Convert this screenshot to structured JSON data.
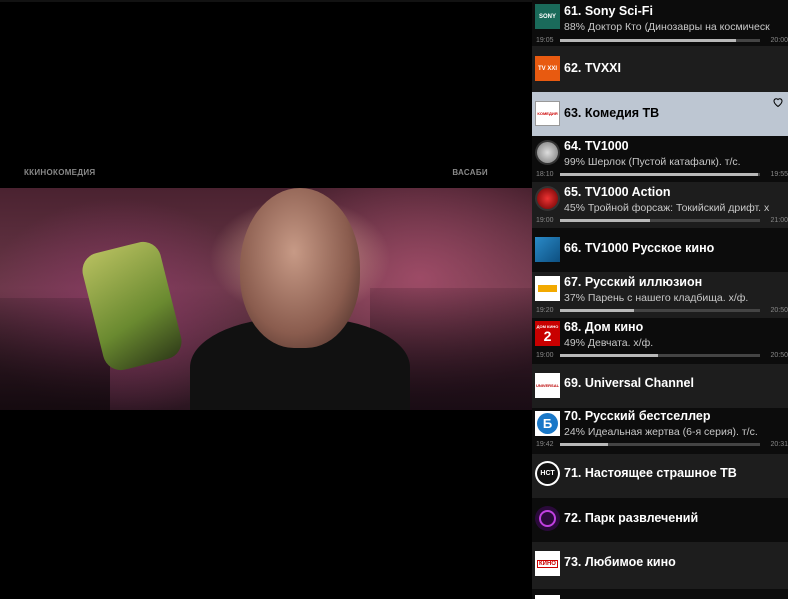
{
  "player": {
    "osd_left": "ККИНОКОМЕДИЯ",
    "osd_right": "ВАСАБИ"
  },
  "channels": [
    {
      "title": "61. Sony Sci-Fi",
      "program": "88% Доктор Кто (Динозавры на космическ",
      "start": "19:05",
      "end": "20:00",
      "progress": 0.88,
      "logo": "sony-scifi-logo",
      "logo_text": "SONY"
    },
    {
      "title": "62. TVXXI",
      "logo": "tvxxi-logo",
      "logo_text": "TV XXI"
    },
    {
      "title": "63. Комедия ТВ",
      "logo": "comedy-tv-logo",
      "logo_text": "КОМЕДИЯ",
      "selected": true,
      "favorite_icon": "heart-icon"
    },
    {
      "title": "64. TV1000",
      "program": "99% Шерлок (Пустой катафалк). т/с.",
      "start": "18:10",
      "end": "19:55",
      "progress": 0.99,
      "logo": "tv1000-logo",
      "logo_text": ""
    },
    {
      "title": "65. TV1000 Action",
      "program": "45% Тройной форсаж: Токийский дрифт. х",
      "start": "19:00",
      "end": "21:00",
      "progress": 0.45,
      "logo": "tv1000-action-logo",
      "logo_text": ""
    },
    {
      "title": "66. TV1000 Русское кино",
      "logo": "tv1000-russian-logo",
      "logo_text": ""
    },
    {
      "title": "67. Русский иллюзион",
      "program": "37% Парень с нашего кладбища. х/ф.",
      "start": "19:20",
      "end": "20:50",
      "progress": 0.37,
      "logo": "russian-illusion-logo",
      "logo_text": ""
    },
    {
      "title": "68. Дом кино",
      "program": "49% Девчата. х/ф.",
      "start": "19:00",
      "end": "20:50",
      "progress": 0.49,
      "logo": "dom-kino-logo",
      "logo_text": "ДОМ КИНО"
    },
    {
      "title": "69. Universal Channel",
      "logo": "universal-logo",
      "logo_text": "UNIVERSAL"
    },
    {
      "title": "70. Русский бестселлер",
      "program": "24% Идеальная жертва (6-я серия). т/с.",
      "start": "19:42",
      "end": "20:31",
      "progress": 0.24,
      "logo": "bestseller-logo",
      "logo_text": "Б"
    },
    {
      "title": "71. Настоящее страшное ТВ",
      "logo": "scary-tv-logo",
      "logo_text": "НСТ"
    },
    {
      "title": "72. Парк развлечений",
      "logo": "park-logo",
      "logo_text": ""
    },
    {
      "title": "73. Любимое кино",
      "logo": "lubimoe-kino-logo",
      "logo_text": "КИНО"
    }
  ],
  "colors": {
    "background": "#000000",
    "row_dark": "#0c0c0c",
    "row_alt": "#1d1d1d",
    "row_selected": "#bdc6d2",
    "progress_fill": "#b8b8b8"
  }
}
